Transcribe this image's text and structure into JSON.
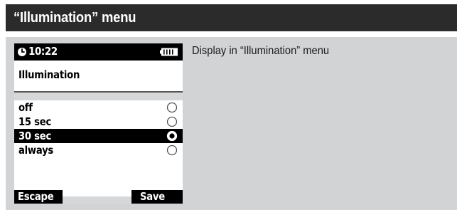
{
  "header": {
    "title": "“Illumination” menu"
  },
  "caption": "Display in “Illumination” menu",
  "device": {
    "status_bar": {
      "time": "10:22",
      "clock_icon": "clock-icon",
      "battery_icon": "battery-icon"
    },
    "screen_title": "Illumination",
    "options": [
      {
        "label": "off",
        "selected": false
      },
      {
        "label": "15 sec",
        "selected": false
      },
      {
        "label": "30 sec",
        "selected": true
      },
      {
        "label": "always",
        "selected": false
      }
    ],
    "softkeys": {
      "left": "Escape",
      "right": "Save"
    }
  },
  "colors": {
    "header_background": "#2b2b2b",
    "panel_background": "#d2d3d5",
    "selection": "#000000"
  }
}
